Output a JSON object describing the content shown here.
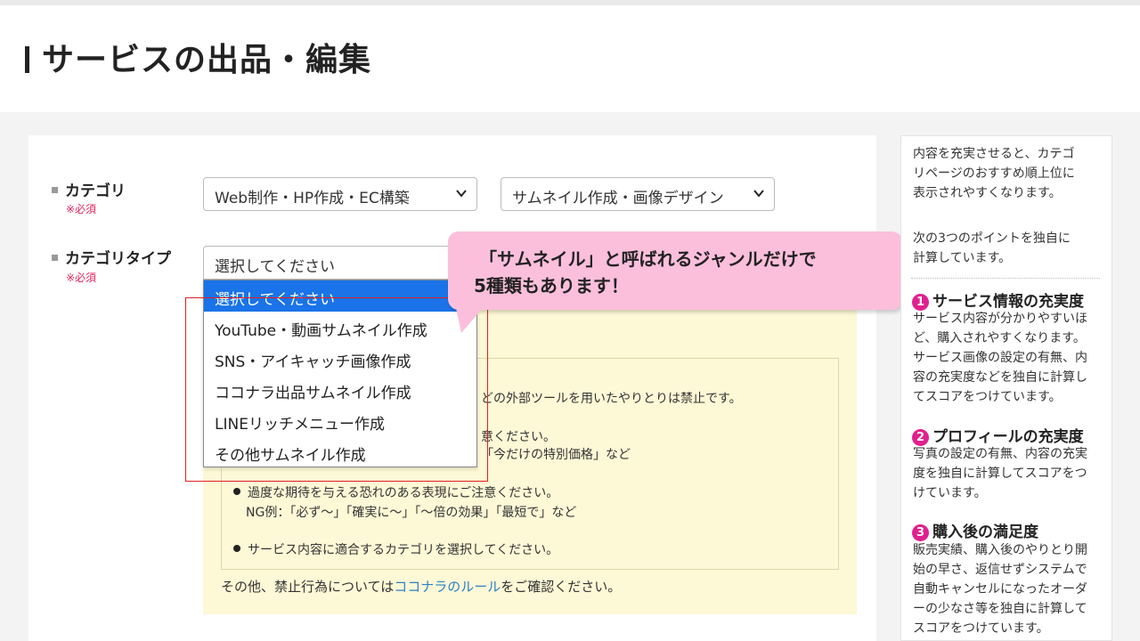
{
  "page_title": "サービスの出品・編集",
  "fields": {
    "category": {
      "label": "カテゴリ",
      "required": "※必須",
      "select1_value": "Web制作・HP作成・EC構築",
      "select2_value": "サムネイル作成・画像デザイン"
    },
    "category_type": {
      "label": "カテゴリタイプ",
      "required": "※必須",
      "select_value": "選択してください",
      "options": [
        "選択してください",
        "YouTube・動画サムネイル作成",
        "SNS・アイキャッチ画像作成",
        "ココナラ出品サムネイル作成",
        "LINEリッチメニュー作成",
        "その他サムネイル作成"
      ]
    }
  },
  "callout": {
    "line1": "「サムネイル」と呼ばれるジャンルだけで",
    "line2": "5種類もあります！"
  },
  "notice": {
    "partial1": "どの外部ツールを用いたやりとりは禁止です。",
    "partial2": "意ください。",
    "partial3": "「今だけの特別価格」など",
    "item2": "過度な期待を与える恐れのある表現にご注意ください。",
    "item2_example": "NG例：「必ず〜」「確実に〜」「〜倍の効果」「最短で」など",
    "item3": "サービス内容に適合するカテゴリを選択してください。",
    "rule_prefix": "その他、禁止行為については",
    "rule_link": "ココナラのルール",
    "rule_suffix": "をご確認ください。"
  },
  "side": {
    "intro_lines": [
      "内容を充実させると、カテゴ",
      "リページのおすすめ順上位に",
      "表示されやすくなります。"
    ],
    "points_lines": [
      "次の3つのポイントを独自に",
      "計算しています。"
    ],
    "point1": {
      "num": "1",
      "title": "サービス情報の充実度",
      "lines": [
        "サービス内容が分かりやすいほ",
        "ど、購入されやすくなります。",
        "サービス画像の設定の有無、内",
        "容の充実度などを独自に計算し",
        "てスコアをつけています。"
      ]
    },
    "point2": {
      "num": "2",
      "title": "プロフィールの充実度",
      "lines": [
        "写真の設定の有無、内容の充実",
        "度を独自に計算してスコアをつ",
        "けています。"
      ]
    },
    "point3": {
      "num": "3",
      "title": "購入後の満足度",
      "lines": [
        "販売実績、購入後のやりとり開",
        "始の早さ、返信せずシステムで",
        "自動キャンセルになったオーダ",
        "ーの少なさ等を独自に計算して",
        "スコアをつけています。"
      ]
    }
  },
  "colors": {
    "accent_pink": "#e0208f",
    "link_blue": "#2d7fc5",
    "required_red": "#e0245e",
    "selected_blue": "#1a73e8",
    "callout_pink": "#fbbfdb",
    "notice_yellow": "#fdf8d6"
  }
}
